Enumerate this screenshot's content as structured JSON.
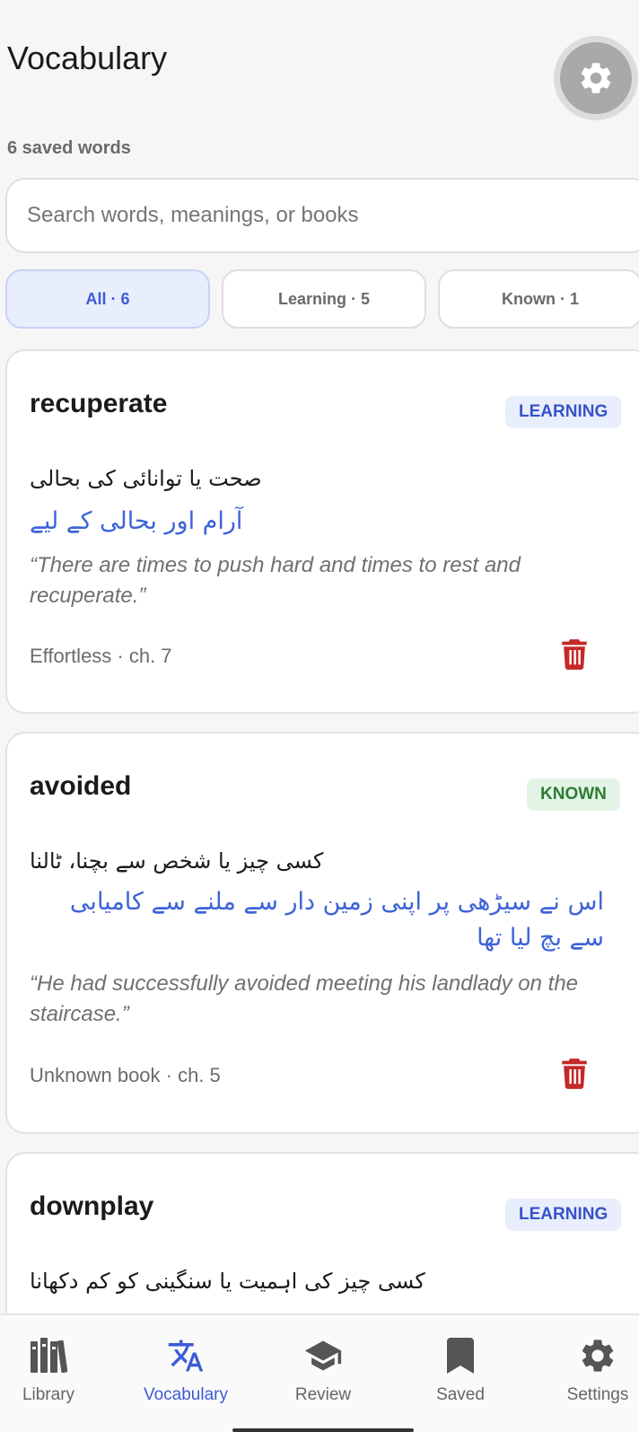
{
  "header": {
    "title": "Vocabulary",
    "saved_count": "6 saved words"
  },
  "search": {
    "placeholder": "Search words, meanings, or books"
  },
  "filters": [
    {
      "label": "All · 6",
      "active": true
    },
    {
      "label": "Learning · 5",
      "active": false
    },
    {
      "label": "Known · 1",
      "active": false
    }
  ],
  "cards": [
    {
      "word": "recuperate",
      "status": "LEARNING",
      "meaning": "صحت یا توانائی کی بحالی",
      "translation": "آرام اور بحالی کے لیے",
      "example": "“There are times to push hard and times to rest and recuperate.”",
      "source": "Effortless · ch. 7"
    },
    {
      "word": "avoided",
      "status": "KNOWN",
      "meaning": "کسی چیز یا شخص سے بچنا، ٹالنا",
      "translation": "اس نے سیڑھی پر اپنی زمین دار سے ملنے سے کامیابی سے بچ لیا تھا",
      "example": "“He had successfully avoided meeting his landlady on the staircase.”",
      "source": "Unknown book · ch. 5"
    },
    {
      "word": "downplay",
      "status": "LEARNING",
      "meaning": "کسی چیز کی اہمیت یا سنگینی کو کم دکھانا"
    }
  ],
  "nav": {
    "items": [
      {
        "label": "Library"
      },
      {
        "label": "Vocabulary"
      },
      {
        "label": "Review"
      },
      {
        "label": "Saved"
      },
      {
        "label": "Settings"
      }
    ]
  },
  "colors": {
    "accent": "#3c5bd6",
    "danger": "#c62828",
    "known": "#2e7d32"
  }
}
